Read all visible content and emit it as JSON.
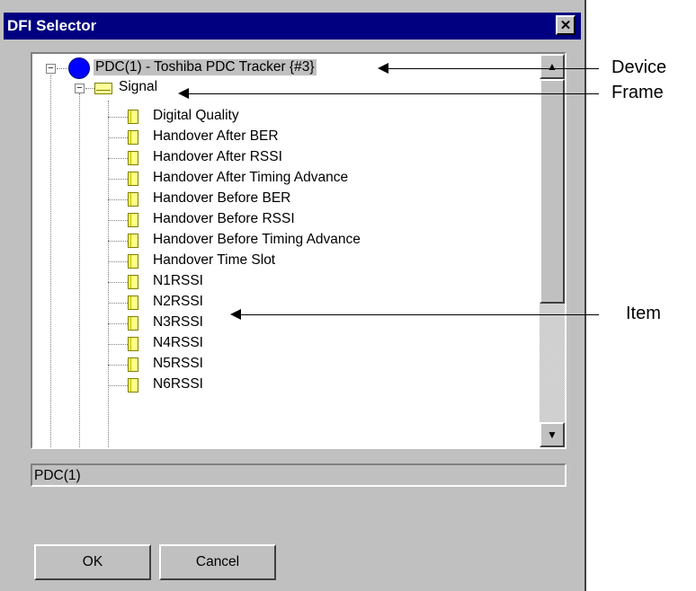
{
  "window": {
    "title": "DFI Selector",
    "close_glyph": "✕"
  },
  "tree": {
    "device": {
      "label": "PDC(1) - Toshiba PDC Tracker {#3}",
      "icon": "blue-circle-icon"
    },
    "frame": {
      "label": "Signal",
      "icon": "envelope-icon"
    },
    "items": [
      "Digital Quality",
      "Handover After BER",
      "Handover After RSSI",
      "Handover After Timing Advance",
      "Handover Before BER",
      "Handover Before RSSI",
      "Handover Before Timing Advance",
      "Handover Time Slot",
      "N1RSSI",
      "N2RSSI",
      "N3RSSI",
      "N4RSSI",
      "N5RSSI",
      "N6RSSI"
    ],
    "expander_glyph": "−"
  },
  "status": {
    "value": "PDC(1)"
  },
  "buttons": {
    "ok": "OK",
    "cancel": "Cancel"
  },
  "callouts": {
    "device": "Device",
    "frame": "Frame",
    "item": "Item"
  },
  "scrollbar": {
    "up_glyph": "▲",
    "down_glyph": "▼"
  }
}
